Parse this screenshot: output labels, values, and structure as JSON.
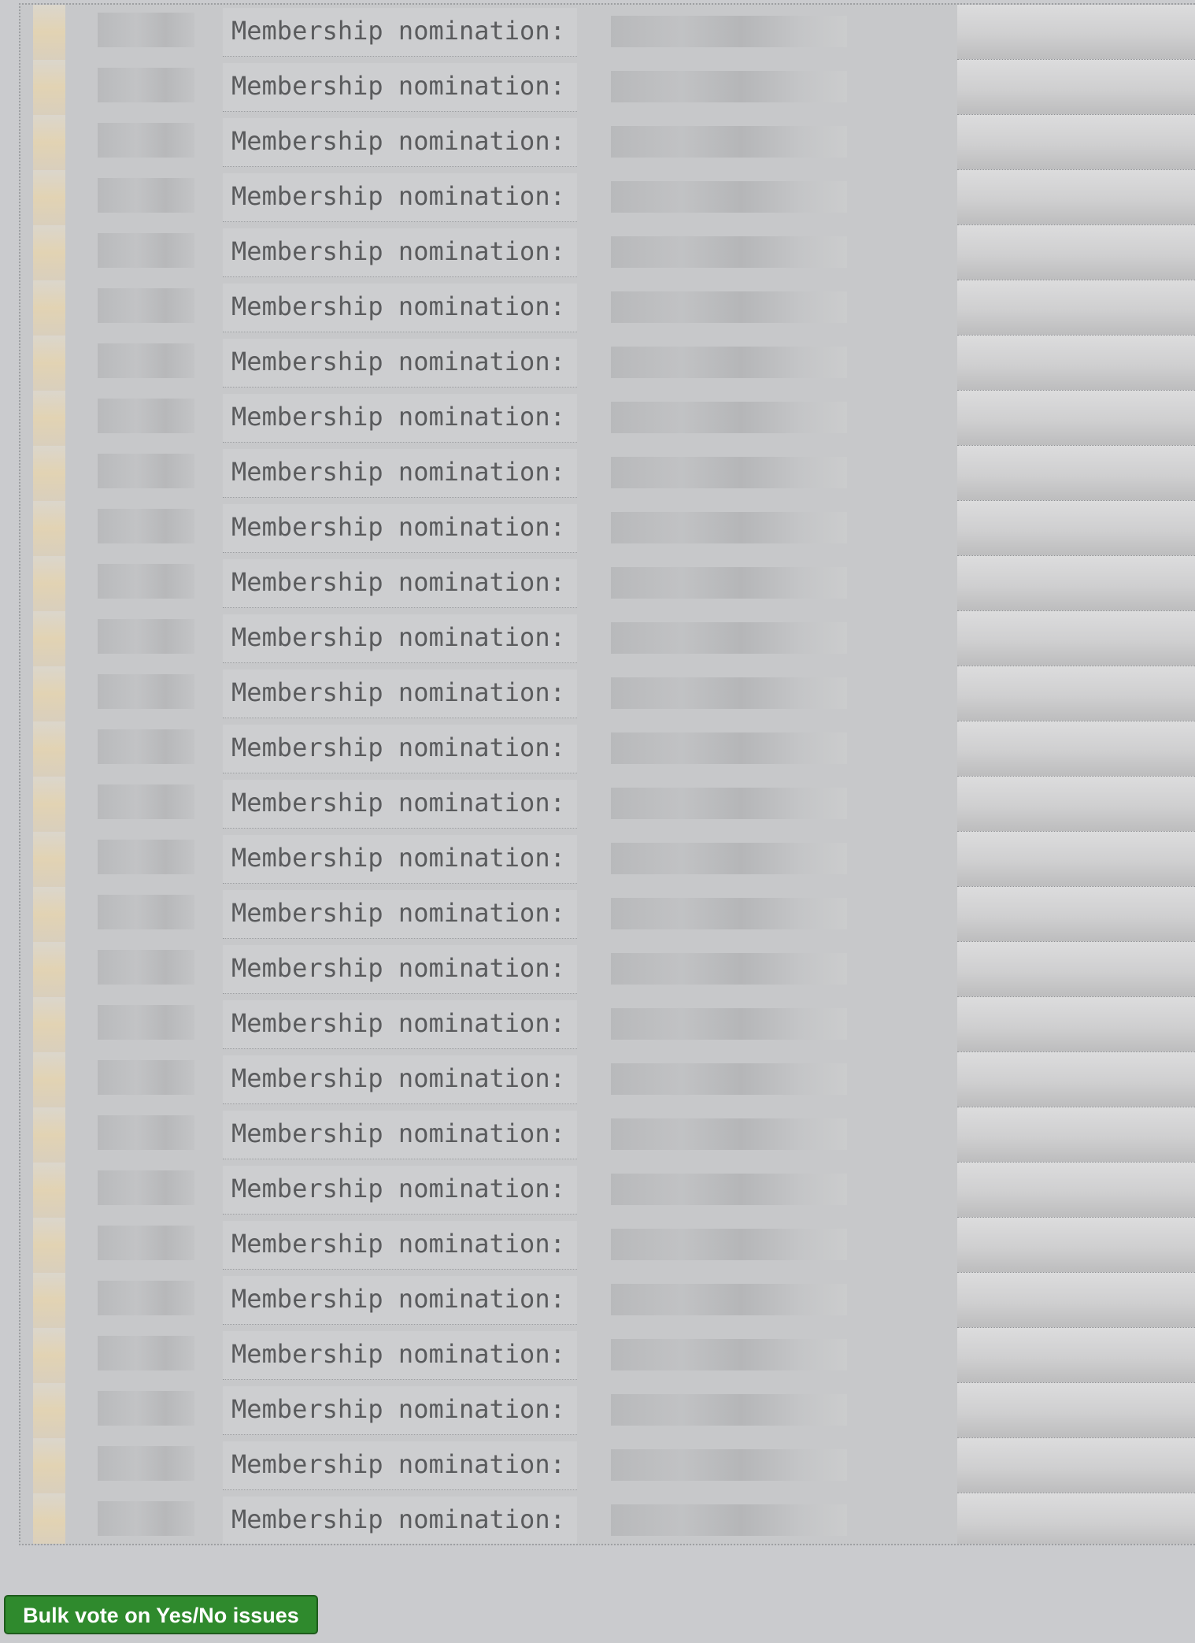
{
  "issues": {
    "row_label": "Membership nomination:",
    "rows": [
      {
        "label": "Membership nomination:"
      },
      {
        "label": "Membership nomination:"
      },
      {
        "label": "Membership nomination:"
      },
      {
        "label": "Membership nomination:"
      },
      {
        "label": "Membership nomination:"
      },
      {
        "label": "Membership nomination:"
      },
      {
        "label": "Membership nomination:"
      },
      {
        "label": "Membership nomination:"
      },
      {
        "label": "Membership nomination:"
      },
      {
        "label": "Membership nomination:"
      },
      {
        "label": "Membership nomination:"
      },
      {
        "label": "Membership nomination:"
      },
      {
        "label": "Membership nomination:"
      },
      {
        "label": "Membership nomination:"
      },
      {
        "label": "Membership nomination:"
      },
      {
        "label": "Membership nomination:"
      },
      {
        "label": "Membership nomination:"
      },
      {
        "label": "Membership nomination:"
      },
      {
        "label": "Membership nomination:"
      },
      {
        "label": "Membership nomination:"
      },
      {
        "label": "Membership nomination:"
      },
      {
        "label": "Membership nomination:"
      },
      {
        "label": "Membership nomination:"
      },
      {
        "label": "Membership nomination:"
      },
      {
        "label": "Membership nomination:"
      },
      {
        "label": "Membership nomination:"
      },
      {
        "label": "Membership nomination:"
      },
      {
        "label": "Membership nomination:"
      }
    ]
  },
  "actions": {
    "bulk_vote_label": "Bulk vote on Yes/No issues",
    "bulk_vote_color": "#2f8a2d"
  },
  "colors": {
    "page_background": "#cacbce",
    "label_text": "#5a5b5d"
  }
}
